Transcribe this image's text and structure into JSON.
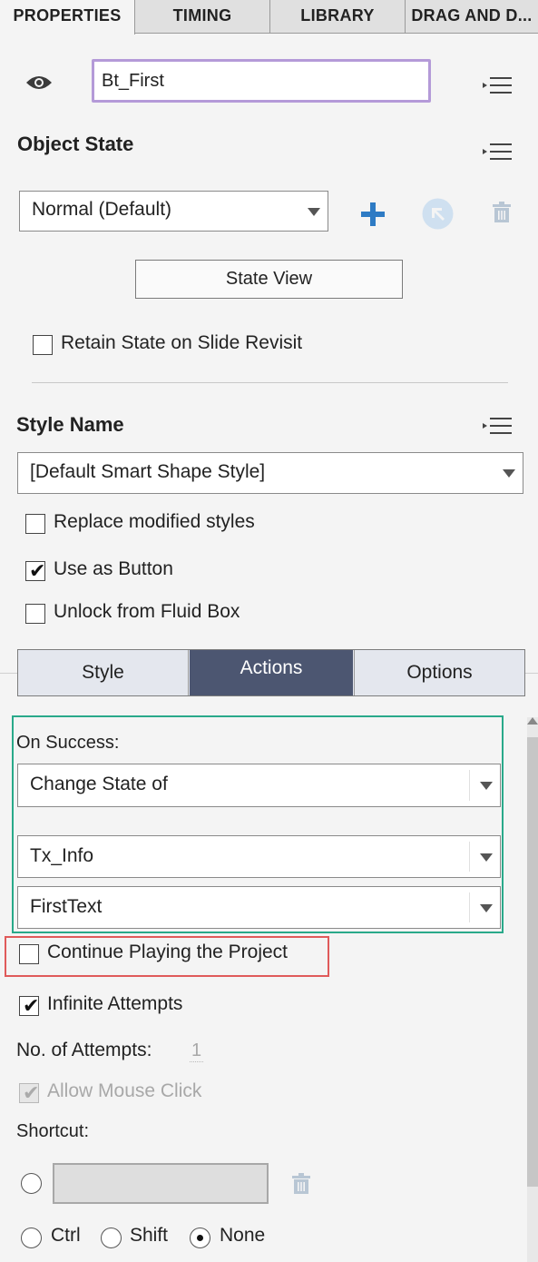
{
  "tabs": [
    {
      "label": "PROPERTIES",
      "active": true
    },
    {
      "label": "TIMING",
      "active": false
    },
    {
      "label": "LIBRARY",
      "active": false
    },
    {
      "label": "DRAG AND D...",
      "active": false
    }
  ],
  "object_name": {
    "value": "Bt_First"
  },
  "object_state": {
    "title": "Object State",
    "dropdown_value": "Normal (Default)",
    "state_view_label": "State View",
    "retain_state_label": "Retain State on Slide Revisit",
    "icons": [
      "eye-icon",
      "menu-icon",
      "plus-icon",
      "arrow-icon",
      "trash-icon"
    ]
  },
  "style_name": {
    "title": "Style Name",
    "dropdown_value": "[Default Smart Shape Style]",
    "replace_label": "Replace modified styles",
    "use_as_button_label": "Use as Button",
    "unlock_fluid_label": "Unlock from Fluid Box"
  },
  "segments": [
    {
      "label": "Style",
      "active": false
    },
    {
      "label": "Actions",
      "active": true
    },
    {
      "label": "Options",
      "active": false
    }
  ],
  "actions": {
    "on_success_label": "On Success:",
    "action_value": "Change State of",
    "target_value": "Tx_Info",
    "state_value": "FirstText",
    "continue_label": "Continue Playing the Project",
    "infinite_label": "Infinite Attempts",
    "attempts_label": "No. of Attempts:",
    "attempts_value": "1",
    "mouse_click_label": "Allow Mouse Click",
    "shortcut_label": "Shortcut:",
    "modifiers": [
      {
        "label": "Ctrl",
        "selected": false
      },
      {
        "label": "Shift",
        "selected": false
      },
      {
        "label": "None",
        "selected": true
      }
    ]
  },
  "colors": {
    "highlight_green": "#29a98a",
    "highlight_red": "#e05a5a",
    "accent_blue": "#2e7bc4",
    "active_segment": "#4c5671"
  }
}
